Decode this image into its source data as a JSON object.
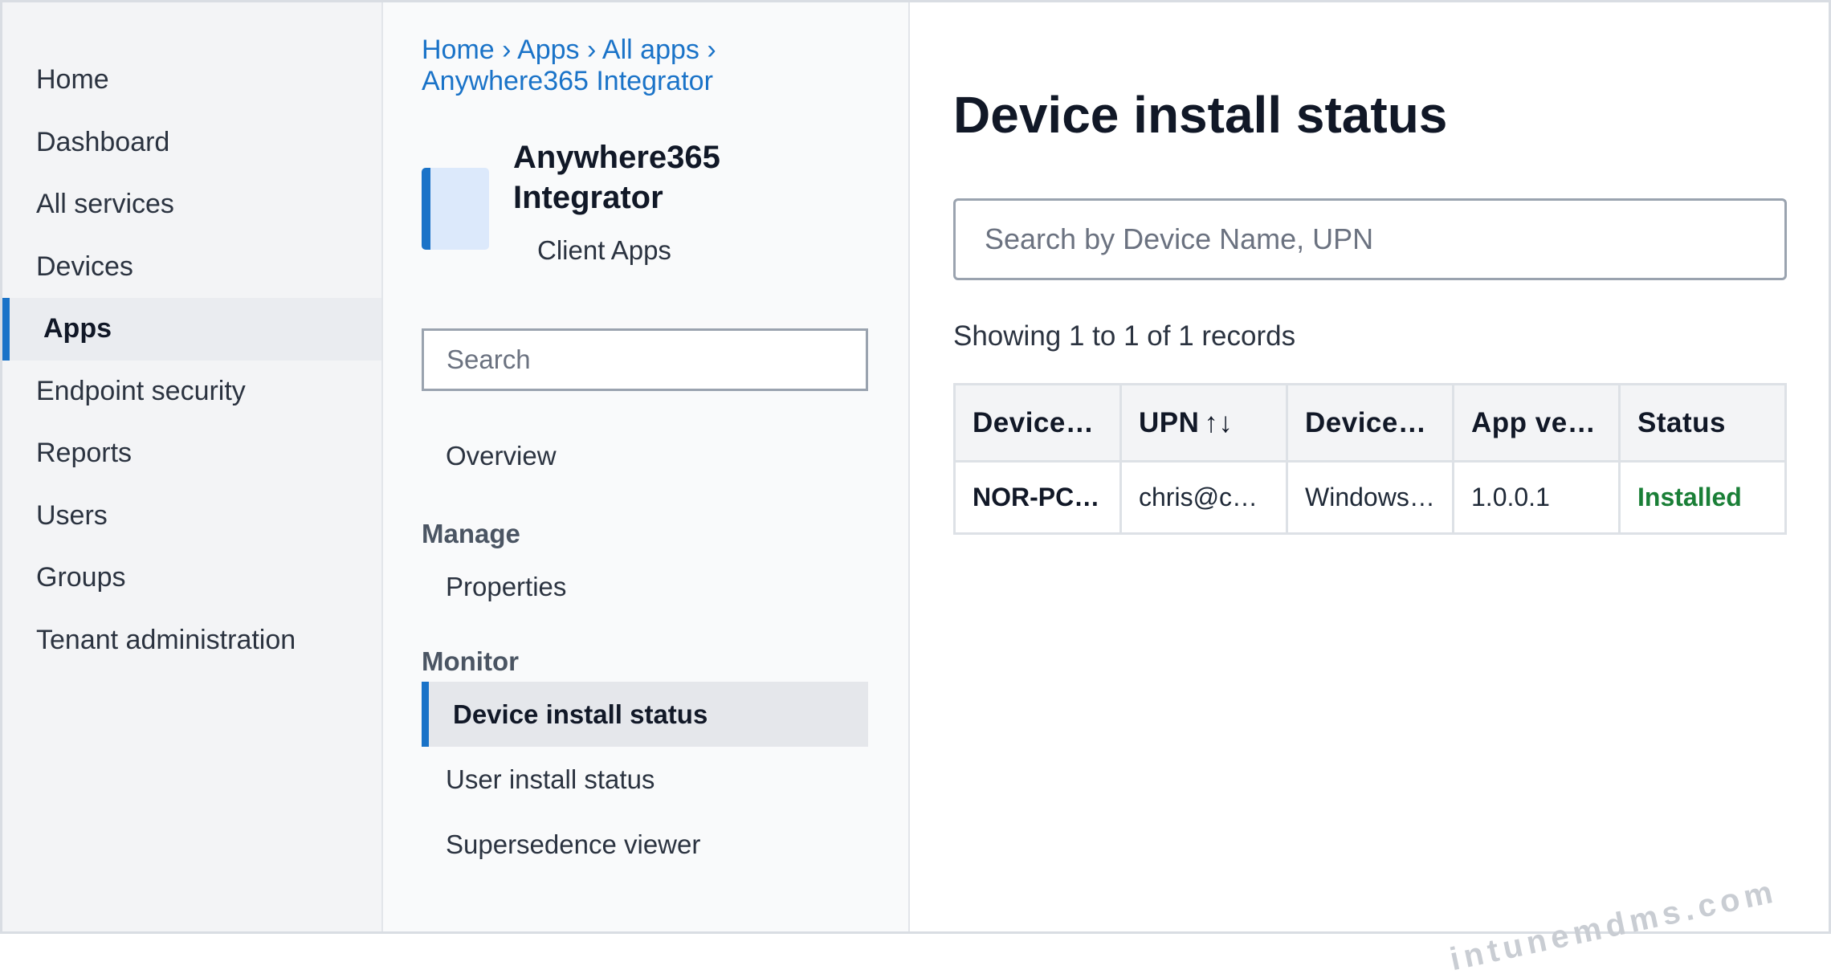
{
  "left_nav": {
    "items": [
      {
        "label": "Home"
      },
      {
        "label": "Dashboard"
      },
      {
        "label": "All services"
      },
      {
        "label": "Devices"
      },
      {
        "label": "Apps",
        "active": true
      },
      {
        "label": "Endpoint security"
      },
      {
        "label": "Reports"
      },
      {
        "label": "Users"
      },
      {
        "label": "Groups"
      },
      {
        "label": "Tenant administration"
      }
    ]
  },
  "breadcrumb": [
    "Home",
    "Apps",
    "All apps",
    "Anywhere365 Integrator"
  ],
  "breadcrumb_separator": "›",
  "app": {
    "title": "Anywhere365 Integrator",
    "subtitle": "Client Apps",
    "icon": "app-tile-icon"
  },
  "side_search": {
    "placeholder": "Search",
    "value": ""
  },
  "menu": {
    "overview": "Overview",
    "manage_heading": "Manage",
    "properties": "Properties",
    "monitor_heading": "Monitor",
    "device_install_status": "Device install status",
    "user_install_status": "User install status",
    "supersedence_viewer": "Supersedence viewer"
  },
  "main": {
    "title": "Device install status",
    "search": {
      "placeholder": "Search by Device Name, UPN",
      "value": ""
    },
    "records_text": "Showing 1 to 1 of 1 records",
    "table": {
      "headers": [
        "Device…",
        "UPN",
        "Device…",
        "App ve…",
        "Status"
      ],
      "upn_sort_icon": "↑↓",
      "rows": [
        {
          "device_name": "NOR-PC…",
          "upn": "chris@c…",
          "device_os": "Windows…",
          "app_version": "1.0.0.1",
          "status": "Installed"
        }
      ]
    }
  },
  "watermark": "intunemdms.com",
  "colors": {
    "accent": "#1a73c8",
    "status_installed": "#1a7f37",
    "nav_background": "#f3f4f6"
  }
}
